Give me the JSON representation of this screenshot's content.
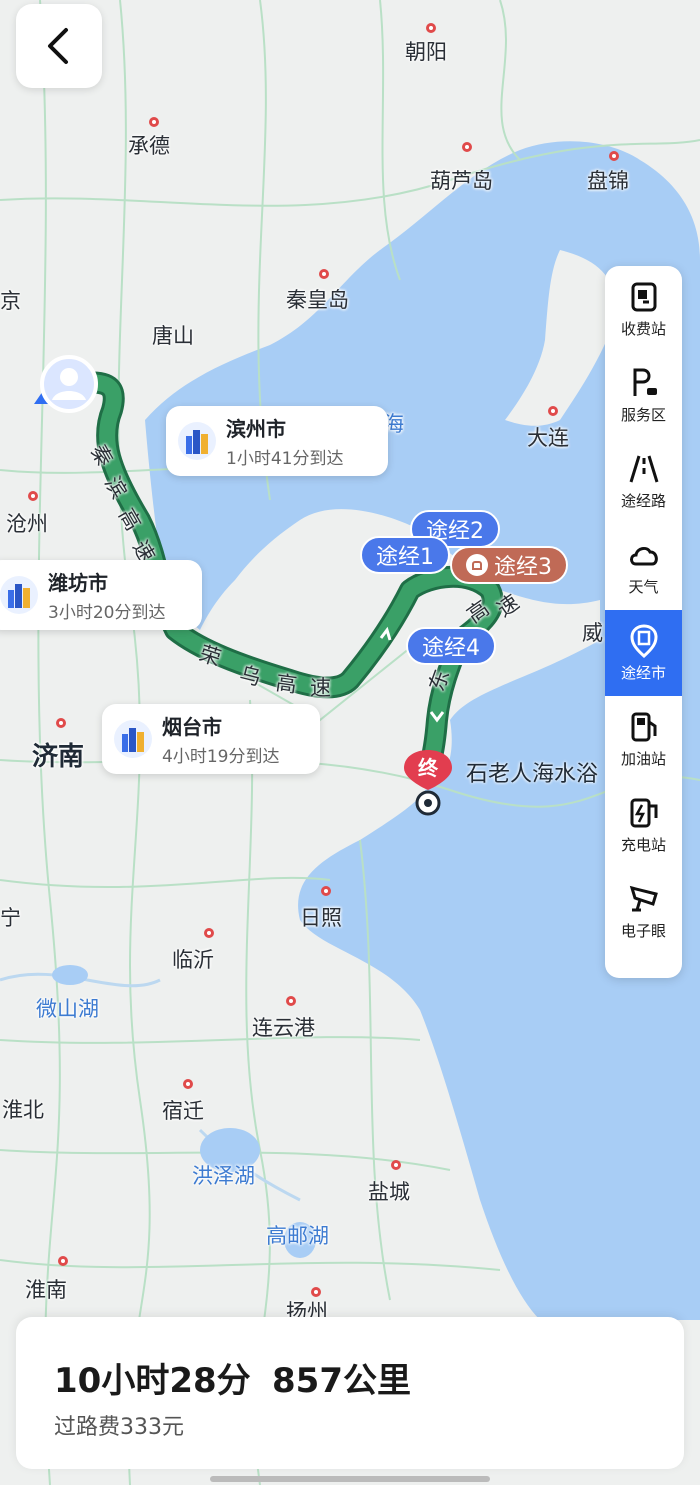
{
  "map": {
    "water_color": "#a8cdf5",
    "land_color": "#eef0ef",
    "route_color": "#2e8b57",
    "cities": [
      {
        "name": "朝阳",
        "cls": ""
      },
      {
        "name": "承德",
        "cls": ""
      },
      {
        "name": "葫芦岛",
        "cls": ""
      },
      {
        "name": "盘锦",
        "cls": ""
      },
      {
        "name": "秦皇岛",
        "cls": ""
      },
      {
        "name": "唐山",
        "cls": ""
      },
      {
        "name": "京",
        "cls": ""
      },
      {
        "name": "大连",
        "cls": ""
      },
      {
        "name": "海",
        "cls": "water"
      },
      {
        "name": "沧州",
        "cls": ""
      },
      {
        "name": "威",
        "cls": ""
      },
      {
        "name": "济南",
        "cls": "big"
      },
      {
        "name": "日照",
        "cls": ""
      },
      {
        "name": "宁",
        "cls": ""
      },
      {
        "name": "临沂",
        "cls": ""
      },
      {
        "name": "微山湖",
        "cls": "water"
      },
      {
        "name": "连云港",
        "cls": ""
      },
      {
        "name": "淮北",
        "cls": ""
      },
      {
        "name": "宿迁",
        "cls": ""
      },
      {
        "name": "洪泽湖",
        "cls": "water"
      },
      {
        "name": "盐城",
        "cls": ""
      },
      {
        "name": "高邮湖",
        "cls": "water"
      },
      {
        "name": "淮南",
        "cls": ""
      },
      {
        "name": "扬州",
        "cls": ""
      }
    ],
    "road_labels": [
      {
        "text": "秦"
      },
      {
        "text": "滨"
      },
      {
        "text": "高"
      },
      {
        "text": "速"
      },
      {
        "text": "荣"
      },
      {
        "text": "乌"
      },
      {
        "text": "高"
      },
      {
        "text": "速"
      },
      {
        "text": "东"
      },
      {
        "text": "高"
      },
      {
        "text": "速"
      }
    ]
  },
  "back_button": {
    "icon": "chevron-left-icon"
  },
  "toolbar": {
    "items": [
      {
        "label": "收费站",
        "icon": "toll-station-icon",
        "active": false
      },
      {
        "label": "服务区",
        "icon": "service-area-icon",
        "active": false
      },
      {
        "label": "途经路",
        "icon": "via-road-icon",
        "active": false
      },
      {
        "label": "天气",
        "icon": "weather-cloud-icon",
        "active": false
      },
      {
        "label": "途经市",
        "icon": "via-city-icon",
        "active": true
      },
      {
        "label": "加油站",
        "icon": "gas-station-icon",
        "active": false
      },
      {
        "label": "充电站",
        "icon": "charging-station-icon",
        "active": false
      },
      {
        "label": "电子眼",
        "icon": "speed-camera-icon",
        "active": false
      }
    ],
    "active_color": "#2f6ef2"
  },
  "bubbles": [
    {
      "city": "滨州市",
      "time": "1小时41分到达"
    },
    {
      "city": "潍坊市",
      "time": "3小时20分到达"
    },
    {
      "city": "烟台市",
      "time": "4小时19分到达"
    }
  ],
  "waypoints": [
    {
      "label": "途经2",
      "style": "blue"
    },
    {
      "label": "途经1",
      "style": "blue"
    },
    {
      "label": "途经3",
      "style": "brown"
    },
    {
      "label": "途经4",
      "style": "blue"
    }
  ],
  "destination": {
    "marker": "终",
    "name": "石老人海水浴"
  },
  "summary": {
    "duration": "10小时28分",
    "distance": "857公里",
    "toll": "过路费333元"
  }
}
